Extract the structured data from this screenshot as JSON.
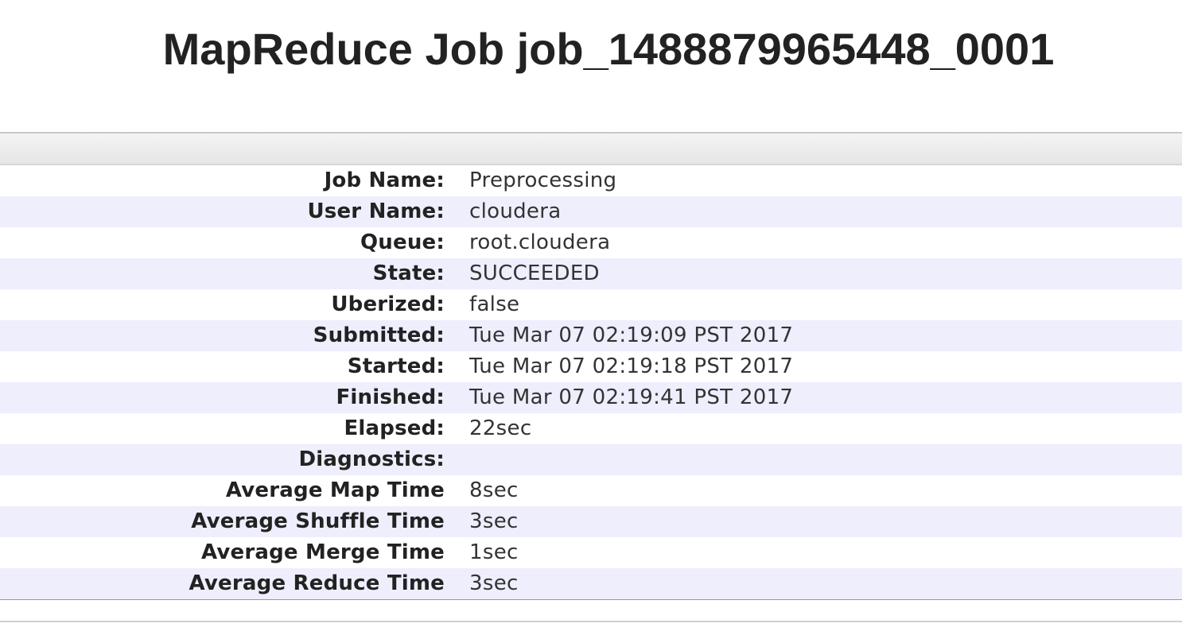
{
  "page": {
    "title": "MapReduce Job job_1488879965448_0001"
  },
  "job_info": [
    {
      "label": "Job Name:",
      "value": "Preprocessing"
    },
    {
      "label": "User Name:",
      "value": "cloudera"
    },
    {
      "label": "Queue:",
      "value": "root.cloudera"
    },
    {
      "label": "State:",
      "value": "SUCCEEDED"
    },
    {
      "label": "Uberized:",
      "value": "false"
    },
    {
      "label": "Submitted:",
      "value": "Tue Mar 07 02:19:09 PST 2017"
    },
    {
      "label": "Started:",
      "value": "Tue Mar 07 02:19:18 PST 2017"
    },
    {
      "label": "Finished:",
      "value": "Tue Mar 07 02:19:41 PST 2017"
    },
    {
      "label": "Elapsed:",
      "value": "22sec"
    },
    {
      "label": "Diagnostics:",
      "value": ""
    },
    {
      "label": "Average Map Time",
      "value": "8sec"
    },
    {
      "label": "Average Shuffle Time",
      "value": "3sec"
    },
    {
      "label": "Average Merge Time",
      "value": "1sec"
    },
    {
      "label": "Average Reduce Time",
      "value": "3sec"
    }
  ]
}
